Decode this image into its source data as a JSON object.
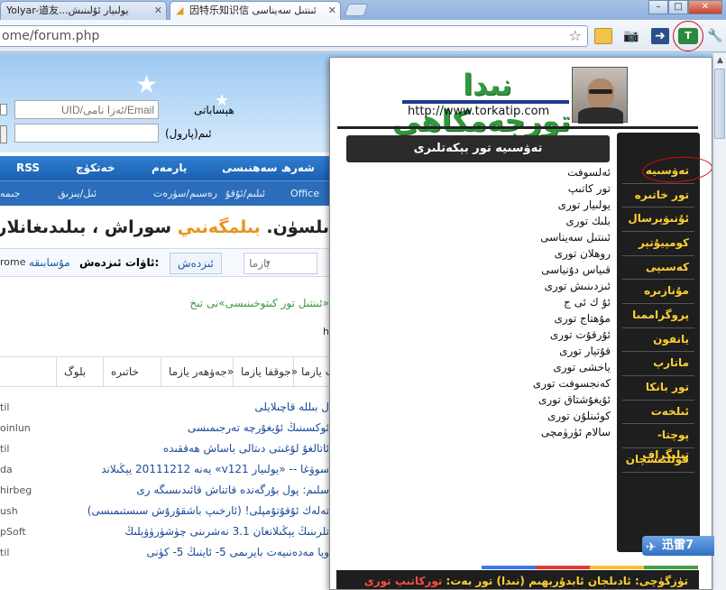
{
  "tabs": [
    {
      "label": "Yolyar-道友...يولىيار ئۇلىنىش",
      "active": false
    },
    {
      "label": "因特乐知识信 ئىنتىل سەيناسى",
      "active": true
    }
  ],
  "window_controls": {
    "minimize": "–",
    "maximize": "□",
    "close": "✕"
  },
  "address_bar": {
    "url": "ome/forum.php"
  },
  "page": {
    "login": {
      "user_label": "ھېساباتى",
      "user_placeholder": "UID/ئەزا نامى/Email",
      "pass_label": "ئىم(پارول)"
    },
    "nav": [
      "شەرھ سەھنىسى",
      "يارمەم",
      "خەتكۈچ",
      "RSS"
    ],
    "subnav": [
      "Office",
      "ئىلىم/ئۇقۇ",
      "رەسىم/سۈرەت",
      "ئىل/يىزىق",
      "جىمە"
    ],
    "slogan": {
      "part1": "ىلسۈن. ",
      "orange": "بىلمگەنىي",
      "part2": " سوراش ، بىلىدىغانلار د"
    },
    "search": {
      "dropdown": "يازما",
      "search_button": "ئىزدەش",
      "hot_label": "ئاۋات ئىزدەش:",
      "hot_item": "مۇسابىقە",
      "edge": "rome"
    },
    "marquee": "«ئىنتىل تور كىتوخىنىسى»نى تىخ",
    "edge_text": "ht",
    "post_tabs": [
      "ئاۋات يازما",
      "جوقفا يازما»",
      "جەۋھەر يازما»",
      "خاتىرە",
      "بلوگ"
    ],
    "posts": [
      {
        "author": "til",
        "title": "ل بىللە قاچىلايلى"
      },
      {
        "author": "oinlun",
        "title": "ئوكسىنىڭ ئۇيغۇرچە تەرجىمىسى"
      },
      {
        "author": "til",
        "title": "ئاتالغۇ لۇغىتى دىتالى باساش ھەققىدە"
      },
      {
        "author": "da",
        "title": "سوۋغا -- «يولىيار v121» يەنە 20111212 يېڭىلاند"
      },
      {
        "author": "hirbeg",
        "title": "سلىم: پول بۇرگەندە قاتناش قائىدىسىگە رى"
      },
      {
        "author": "ush",
        "title": "تەلەك ئۇقۇتۇمپلى! (ئارخىپ باشقۇرۇش سىستىمىسى)"
      },
      {
        "author": "pSoft",
        "title": "تلرىنىڭ يېڭىلانغان 3.1 نەشرىنى چۈشۈرۈۋېلىڭ"
      },
      {
        "author": "til",
        "title": "وپا مەدەنىيەت بايرىمى 5- ئاينىڭ 5- كۈنى"
      }
    ]
  },
  "popup": {
    "logo_text": "نىدا تورجەمكاھى",
    "logo_url": "http://www.torkatip.com",
    "header": "تەۋسىيە تور بېكەتلىرى",
    "sidebar": [
      "تەۋسىيە",
      "تور خاتىرە",
      "ئۇنىۋېرسال",
      "كومپيۇتېر",
      "كەسىپى",
      "مۇنازىرە",
      "پروگراممىا",
      "يانفون",
      "ماتارپ",
      "تور بانكا",
      "ئىلخەت",
      "پوچتا-تېلېگراف",
      "قوللىنشچان"
    ],
    "list": [
      "ئەلسوفت",
      "تور كاتىپ",
      "يولىيار تورى",
      "بلىك تورى",
      "ئىنتىل سەيناسى",
      "روھلان تورى",
      "قىياس دۇنياسى",
      "ئىزدىنىش تورى",
      "ئۇ ك ئى ج",
      "مۇھتاج تورى",
      "ئۇرقۇت تورى",
      "قۇتيار تورى",
      "ياخشى تورى",
      "كەنجسوفت تورى",
      "ئۇيغۇشتاق تورى",
      "كوئىنلۇن تورى",
      "سالام ئۈرۈمچى"
    ],
    "footer": {
      "text": "تۈزگۈچى: ئادىلجان ئابدۇرېھىم (نىدا) تور بەت: ",
      "link": "توركاتىپ تورى"
    },
    "strip_colors": [
      "#3b78e7",
      "#e53935",
      "#fbc02d",
      "#43a047"
    ]
  },
  "xunlei": {
    "label": "迅雷7"
  },
  "colors": {
    "sidebar_text": "#ffd033",
    "logo_green": "#2f9a3b",
    "nav_blue": "#1b5fb0",
    "annotation_red": "#d01010"
  }
}
